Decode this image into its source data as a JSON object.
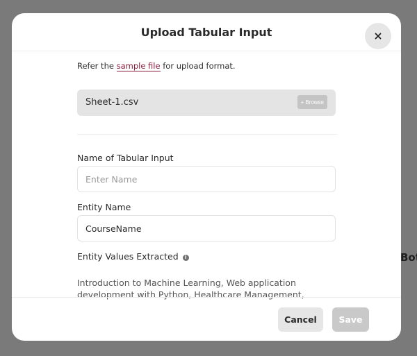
{
  "backdrop": {
    "partial_text": "Bot"
  },
  "modal": {
    "title": "Upload Tabular Input",
    "hint": {
      "prefix": "Refer the",
      "link": "sample file",
      "suffix": "for upload format."
    },
    "file": {
      "name": "Sheet-1.csv",
      "browse_label": "Browse",
      "browse_icon": "plus-icon"
    },
    "fields": {
      "name_label": "Name of Tabular Input",
      "name_placeholder": "Enter Name",
      "name_value": "",
      "entity_label": "Entity Name",
      "entity_value": "CourseName",
      "values_label": "Entity Values Extracted",
      "values_text": "Introduction to Machine Learning, Web application development with Python, Healthcare Management, Introduction to Marketing..."
    },
    "footer": {
      "cancel_label": "Cancel",
      "save_label": "Save"
    }
  }
}
